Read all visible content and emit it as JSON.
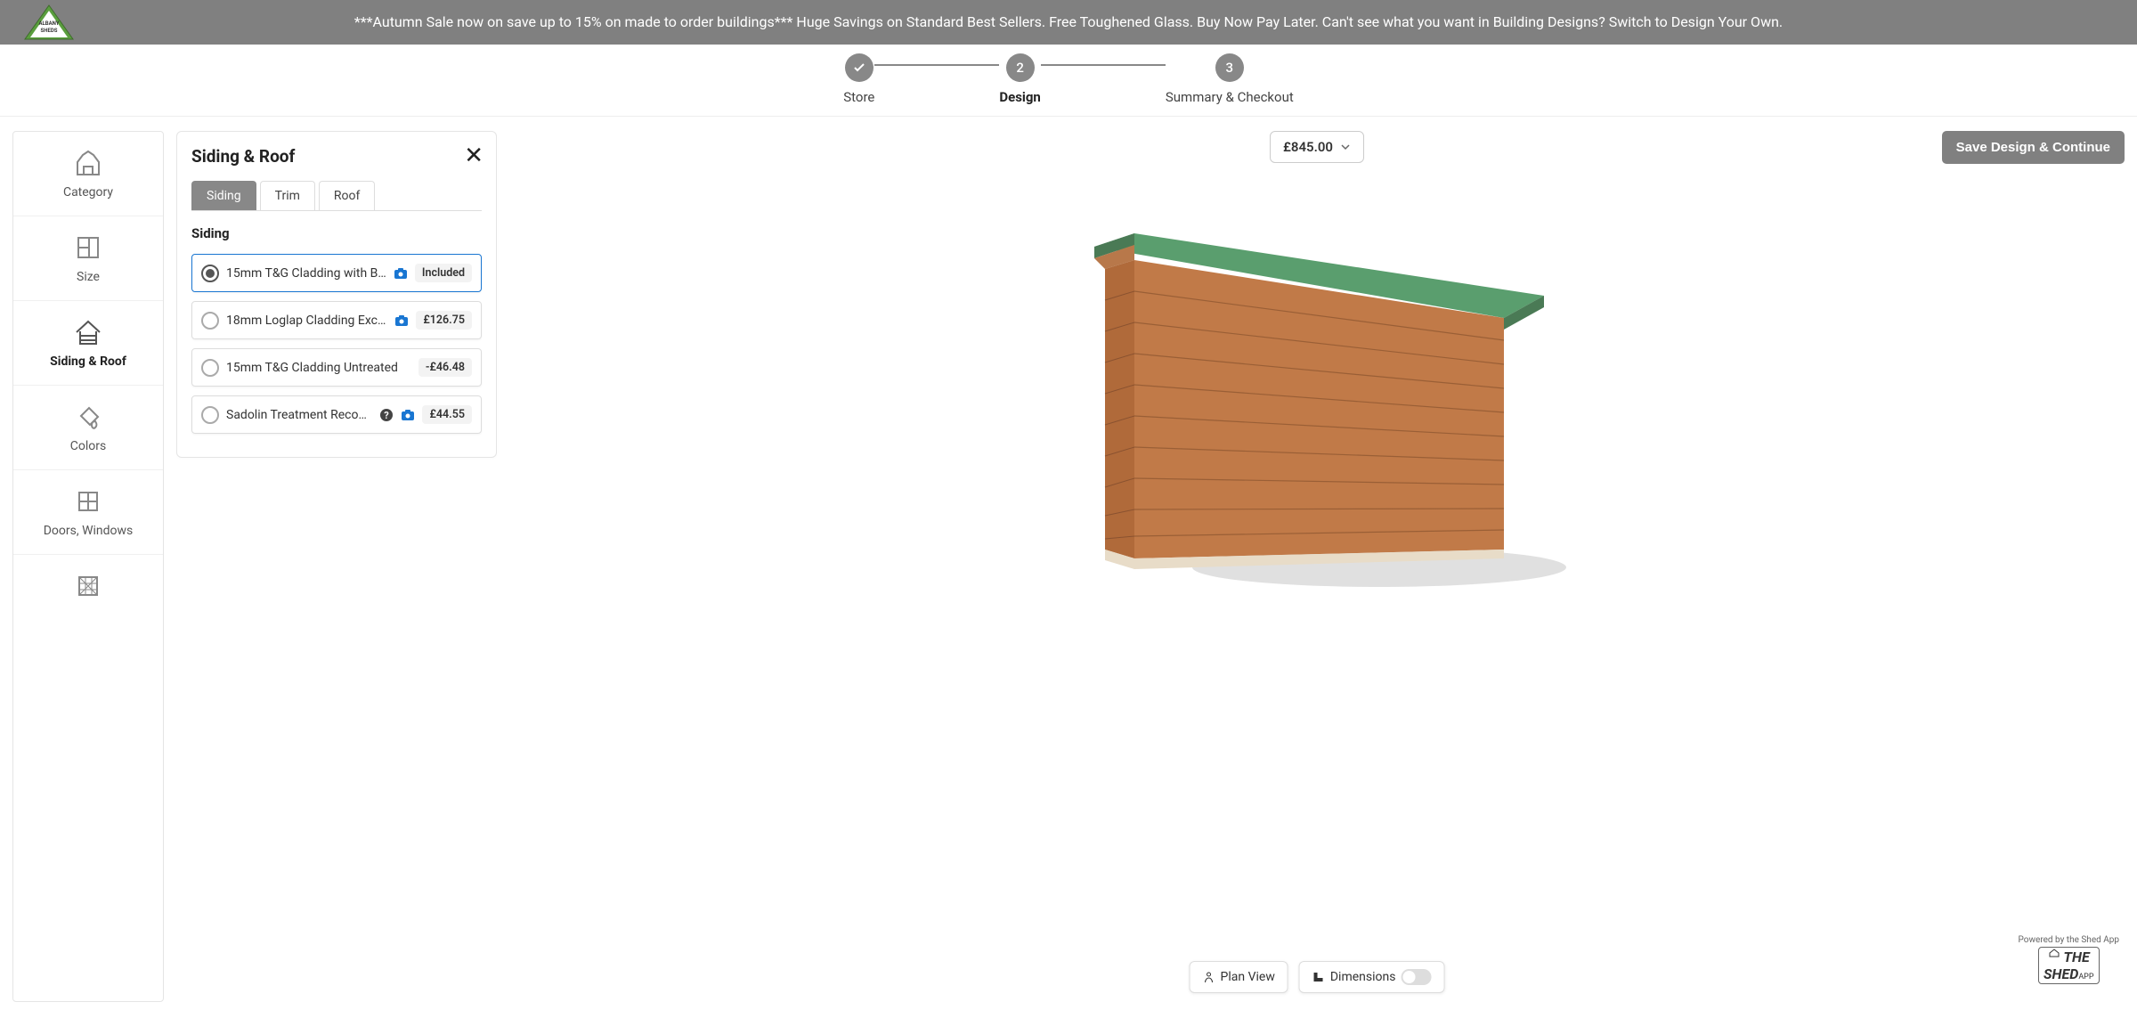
{
  "banner": {
    "text": "***Autumn Sale now on save up to 15% on made to order buildings*** Huge Savings on Standard Best Sellers. Free Toughened Glass. Buy Now Pay Later. Can't see what you want in Building Designs? Switch to Design Your Own."
  },
  "logo": {
    "text": "ALBANY SHEDS"
  },
  "stepper": {
    "steps": [
      {
        "num": "✓",
        "label": "Store",
        "done": true
      },
      {
        "num": "2",
        "label": "Design",
        "active": true
      },
      {
        "num": "3",
        "label": "Summary & Checkout"
      }
    ]
  },
  "nav": {
    "items": [
      {
        "label": "Category"
      },
      {
        "label": "Size"
      },
      {
        "label": "Siding & Roof",
        "active": true
      },
      {
        "label": "Colors"
      },
      {
        "label": "Doors, Windows"
      }
    ]
  },
  "panel": {
    "title": "Siding & Roof",
    "tabs": [
      {
        "label": "Siding",
        "active": true
      },
      {
        "label": "Trim"
      },
      {
        "label": "Roof"
      }
    ],
    "section": "Siding",
    "options": [
      {
        "label": "15mm T&G Cladding with B…",
        "price": "Included",
        "selected": true,
        "camera": true
      },
      {
        "label": "18mm Loglap Cladding Exc …",
        "price": "£126.75",
        "camera": true
      },
      {
        "label": "15mm T&G Cladding Untreated",
        "price": "-£46.48"
      },
      {
        "label": "Sadolin Treatment Recom…",
        "price": "£44.55",
        "info": true,
        "camera": true
      }
    ]
  },
  "viewer": {
    "price": "£845.00",
    "save_label": "Save Design & Continue",
    "plan_view": "Plan View",
    "dimensions": "Dimensions",
    "powered_by": "Powered by the Shed App",
    "brand": "SHED",
    "brand_suffix": "APP"
  }
}
